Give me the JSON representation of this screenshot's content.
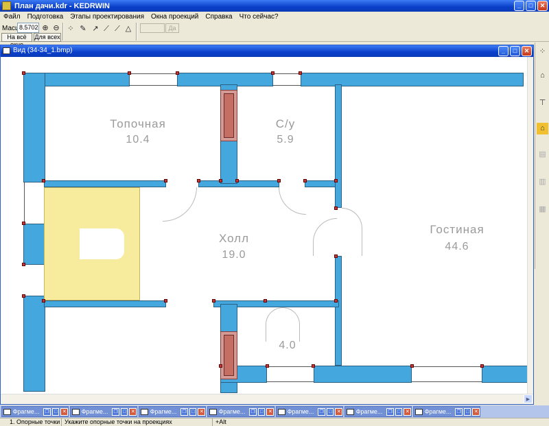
{
  "window": {
    "title": "План дачи.kdr - KEDRWIN"
  },
  "menu": [
    "Файл",
    "Подготовка",
    "Этапы проектирования",
    "Окна проекций",
    "Справка",
    "Что сейчас?"
  ],
  "toolbar": {
    "scale_label": "Масшт",
    "scale_value": "8.5702",
    "fit_window_label": "На всё окно",
    "fit_all_label": "Для всех",
    "ok_label": "Да"
  },
  "child_window": {
    "title": "Вид (34-34_1.bmp)"
  },
  "rooms": [
    {
      "name": "Топочная",
      "area": "10.4"
    },
    {
      "name": "С/у",
      "area": "5.9"
    },
    {
      "name": "Холл",
      "area": "19.0"
    },
    {
      "name": "Гостиная",
      "area": "44.6"
    },
    {
      "name": "",
      "area": "4.0"
    }
  ],
  "fragments": [
    "Фрагме...",
    "Фрагме...",
    "Фрагме...",
    "Фрагме...",
    "Фрагме...",
    "Фрагме...",
    "Фрагме..."
  ],
  "status": {
    "mode": "1. Опорные точки",
    "hint": "Укажите опорные точки на проекциях",
    "key": "+Alt"
  },
  "colors": {
    "wall": "#44a8df",
    "stairs": "#f7ec9e",
    "chimney": "#d49a96",
    "vertex": "#c03a3a",
    "titlebar": "#0a3fc9"
  },
  "icons": [
    "points-icon",
    "zoom-in-icon",
    "zoom-out-icon",
    "reference-points-icon",
    "tool-a-icon",
    "tool-b-icon",
    "tool-c-icon"
  ]
}
